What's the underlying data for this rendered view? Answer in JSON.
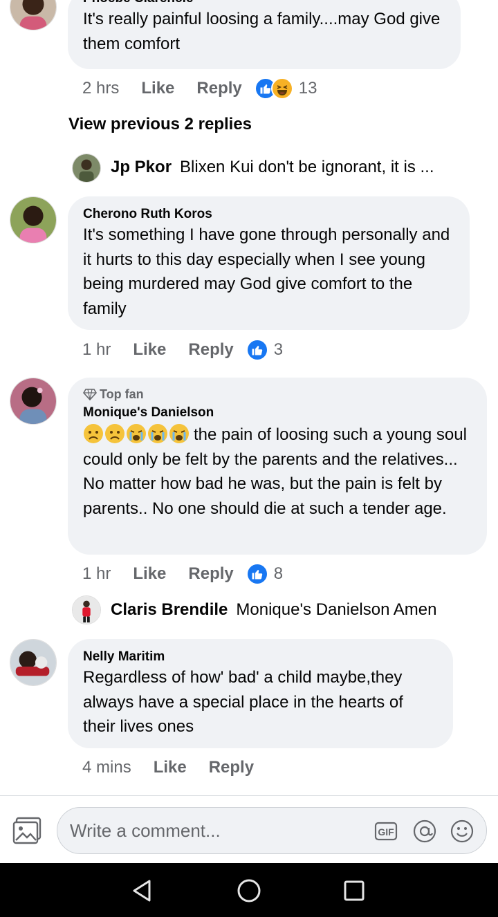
{
  "comments": [
    {
      "author": "Phoebe Clarencie",
      "text": "It's really painful loosing a family....may God give them comfort",
      "time": "2 hrs",
      "like_label": "Like",
      "reply_label": "Reply",
      "reaction_count": "13",
      "reactions": [
        "like-icon",
        "haha-icon"
      ]
    },
    {
      "author": "Cherono Ruth Koros",
      "text": "It's something I have gone through personally and it hurts to this day especially when I see young being murdered may God give comfort to the family",
      "time": "1 hr",
      "like_label": "Like",
      "reply_label": "Reply",
      "reaction_count": "3",
      "reactions": [
        "like-icon"
      ]
    },
    {
      "badge": "Top fan",
      "author": "Monique's Danielson",
      "emojis": [
        "sad-face-icon",
        "sad-face-icon",
        "crying-face-icon",
        "crying-face-icon",
        "crying-face-icon"
      ],
      "text": "the pain of loosing such a young soul could only be felt by the parents and the relatives...  No matter how bad he was, but the pain is felt by parents..  No one should die at such a tender age.",
      "time": "1 hr",
      "like_label": "Like",
      "reply_label": "Reply",
      "reaction_count": "8",
      "reactions": [
        "like-icon"
      ]
    },
    {
      "author": "Nelly Maritim",
      "text": "Regardless of how' bad' a child maybe,they always have a special place in the hearts of their lives ones",
      "time": "4 mins",
      "like_label": "Like",
      "reply_label": "Reply"
    }
  ],
  "view_previous": "View previous 2 replies",
  "replies": [
    {
      "author": "Jp Pkor",
      "text": "Blixen Kui don't be ignorant, it is ..."
    },
    {
      "author": "Claris Brendile",
      "text": "Monique's Danielson Amen"
    }
  ],
  "composer": {
    "placeholder": "Write a comment...",
    "gif_label": "GIF",
    "icons": [
      "photo-icon",
      "gif-icon",
      "mention-icon",
      "emoji-icon"
    ]
  },
  "colors": {
    "bubble": "#f0f2f5",
    "secondary_text": "#65676b",
    "like_blue": "#1877f2",
    "haha_yellow": "#f7b125"
  },
  "navigation": [
    "back-icon",
    "home-icon",
    "recents-icon"
  ]
}
